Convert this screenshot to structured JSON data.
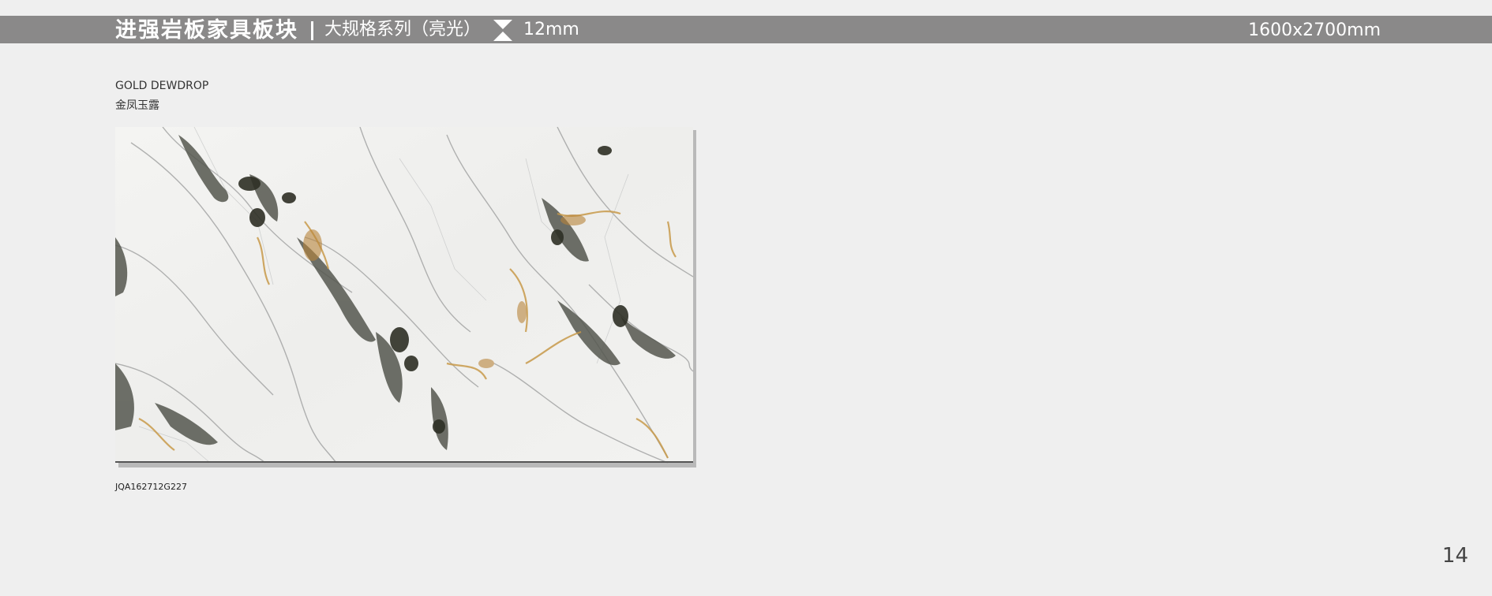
{
  "header": {
    "brand": "进强岩板家具板块",
    "series": "大规格系列（亮光）",
    "thickness": "12mm",
    "size": "1600x2700mm",
    "bar_color": "#8a8989"
  },
  "product": {
    "name_en": "GOLD DEWDROP",
    "name_cn": "金凤玉露",
    "code": "JQA162712G227",
    "image": "marble-slab-image"
  },
  "page_number": "14"
}
